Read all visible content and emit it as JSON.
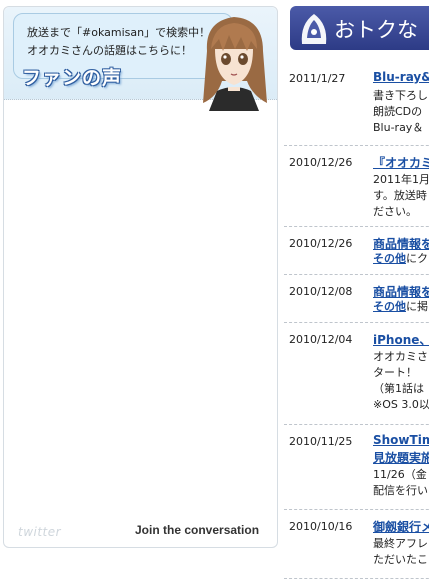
{
  "widget": {
    "bubble_line1": "放送まで「#okamisan」で検索中！",
    "bubble_line2": "オオカミさんの話題はこちらに！",
    "title": "ファンの声",
    "footer_logo": "twitter",
    "join_label": "Join the conversation"
  },
  "news": {
    "banner_title": "おトクな",
    "items": [
      {
        "date": "2011/1/27",
        "title": "Blu-ray&",
        "lines": [
          "書き下ろし",
          "朗読CDの",
          "Blu-ray＆"
        ]
      },
      {
        "date": "2010/12/26",
        "title": "『オオカミ",
        "lines": [
          "2011年1月",
          "す。放送時",
          "ださい。"
        ]
      },
      {
        "date": "2010/12/26",
        "title": "商品情報を",
        "link_line": "その他",
        "link_suffix": "にク"
      },
      {
        "date": "2010/12/08",
        "title": "商品情報を",
        "link_line": "その他",
        "link_suffix": "に掲"
      },
      {
        "date": "2010/12/04",
        "title": "iPhone、",
        "lines": [
          "オオカミさ",
          "タート！",
          "（第1話は",
          "※OS 3.0以"
        ]
      },
      {
        "date": "2010/11/25",
        "title": "ShowTim",
        "title2": "見放題実施",
        "lines": [
          "11/26（金",
          "配信を行い"
        ]
      },
      {
        "date": "2010/10/16",
        "title": "御劔銀行メ",
        "lines": [
          "最終アフレ",
          "ただいたこ"
        ]
      }
    ]
  },
  "colors": {
    "link": "#1a4fa3",
    "banner": "#2d3b86",
    "bubble": "#dff0fb"
  }
}
